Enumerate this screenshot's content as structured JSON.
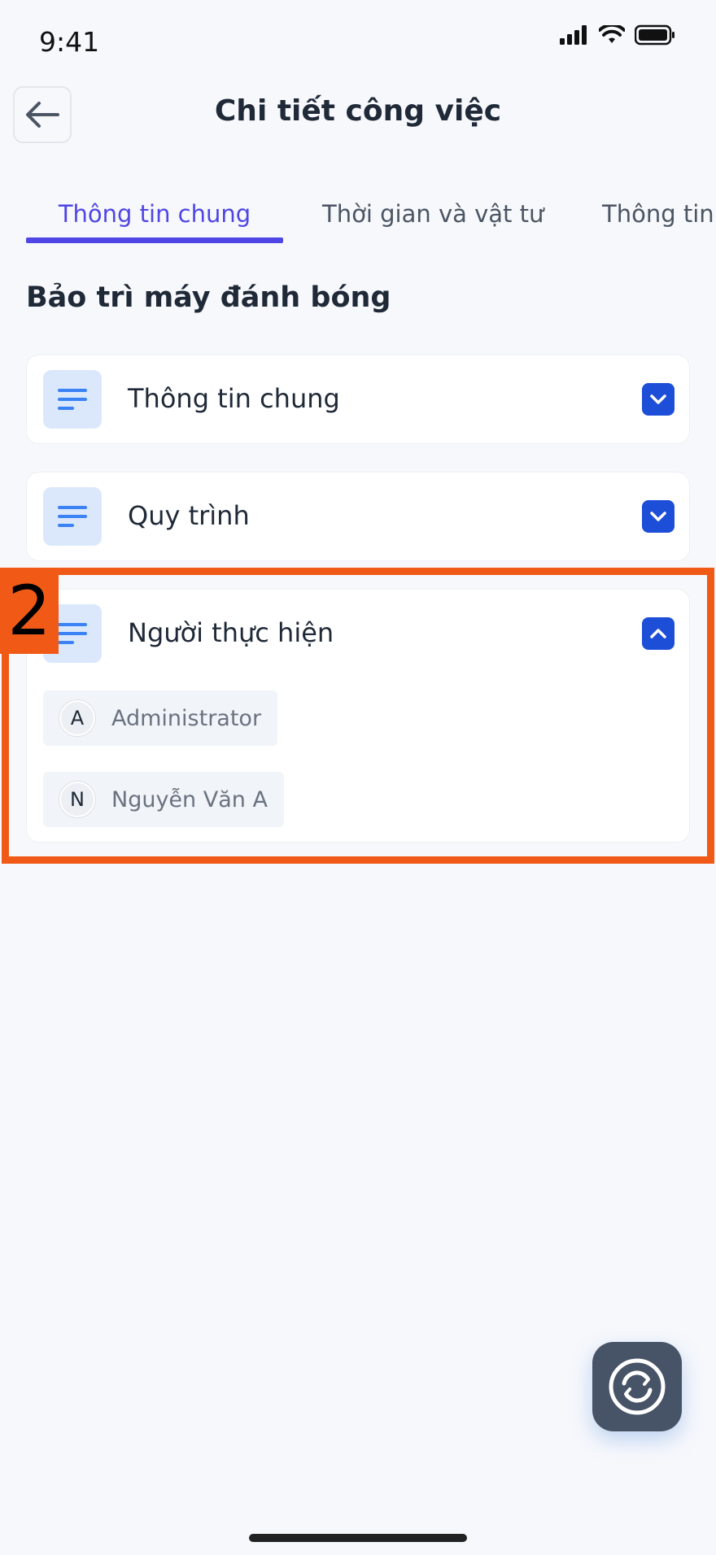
{
  "status_bar": {
    "time": "9:41",
    "icons": [
      "cellular-signal-icon",
      "wifi-icon",
      "battery-icon"
    ]
  },
  "header": {
    "back_icon": "arrow-left-icon",
    "title": "Chi tiết công việc"
  },
  "tabs": [
    {
      "label": "Thông tin chung",
      "active": true
    },
    {
      "label": "Thời gian và vật tư",
      "active": false
    },
    {
      "label": "Thông tin x",
      "active": false
    }
  ],
  "section_title": "Bảo trì máy đánh bóng",
  "cards": [
    {
      "label": "Thông tin chung",
      "icon": "list-lines-icon",
      "expanded": false
    },
    {
      "label": "Quy trình",
      "icon": "list-lines-icon",
      "expanded": false
    },
    {
      "label": "Người thực hiện",
      "icon": "list-lines-icon",
      "expanded": true,
      "people": [
        {
          "initial": "A",
          "name": "Administrator"
        },
        {
          "initial": "N",
          "name": "Nguyễn Văn A"
        }
      ]
    }
  ],
  "annotation": {
    "label": "2",
    "color": "#f05a16"
  },
  "fab": {
    "icon": "sync-icon"
  },
  "colors": {
    "accent": "#4f46e5",
    "toggle": "#1d4ed8",
    "icon_bg": "#dbe8fb",
    "fab": "#475366",
    "background": "#f7f8fc"
  }
}
